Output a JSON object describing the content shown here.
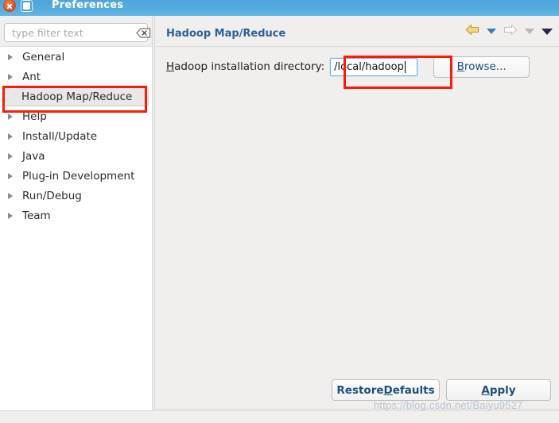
{
  "window": {
    "title": "Preferences",
    "close_icon": "close-icon",
    "maximize_icon": "maximize-icon",
    "titlebar_color": "#55acdf"
  },
  "sidebar": {
    "filter": {
      "placeholder": "type filter text",
      "value": "",
      "clear_icon": "clear-filter-icon"
    },
    "items": [
      {
        "label": "General",
        "expandable": true,
        "selected": false
      },
      {
        "label": "Ant",
        "expandable": true,
        "selected": false
      },
      {
        "label": "Hadoop Map/Reduce",
        "expandable": false,
        "selected": true
      },
      {
        "label": "Help",
        "expandable": true,
        "selected": false
      },
      {
        "label": "Install/Update",
        "expandable": true,
        "selected": false
      },
      {
        "label": "Java",
        "expandable": true,
        "selected": false
      },
      {
        "label": "Plug-in Development",
        "expandable": true,
        "selected": false
      },
      {
        "label": "Run/Debug",
        "expandable": true,
        "selected": false
      },
      {
        "label": "Team",
        "expandable": true,
        "selected": false
      }
    ]
  },
  "page": {
    "title": "Hadoop Map/Reduce",
    "title_color": "#2a6099",
    "nav": {
      "back_icon": "back-arrow-icon",
      "back_dropdown_icon": "back-history-dropdown-icon",
      "forward_icon": "forward-arrow-icon",
      "forward_dropdown_icon": "forward-history-dropdown-icon",
      "menu_icon": "view-menu-dropdown-icon"
    },
    "field": {
      "label_prefix": "H",
      "label_rest": "adoop installation directory:",
      "value": "/local/hadoop",
      "browse_prefix": "B",
      "browse_rest": "rowse..."
    }
  },
  "footer": {
    "restore_prefix": "Restore ",
    "restore_mnemonic": "D",
    "restore_rest": "efaults",
    "apply_prefix": "",
    "apply_mnemonic": "A",
    "apply_rest": "pply"
  },
  "annotations": {
    "highlight_color": "#fb1b08",
    "tree_item": "Hadoop Map/Reduce",
    "input_field": "Hadoop installation directory"
  },
  "watermark": {
    "text": "https://blog.csdn.net/Baiyu9527"
  }
}
